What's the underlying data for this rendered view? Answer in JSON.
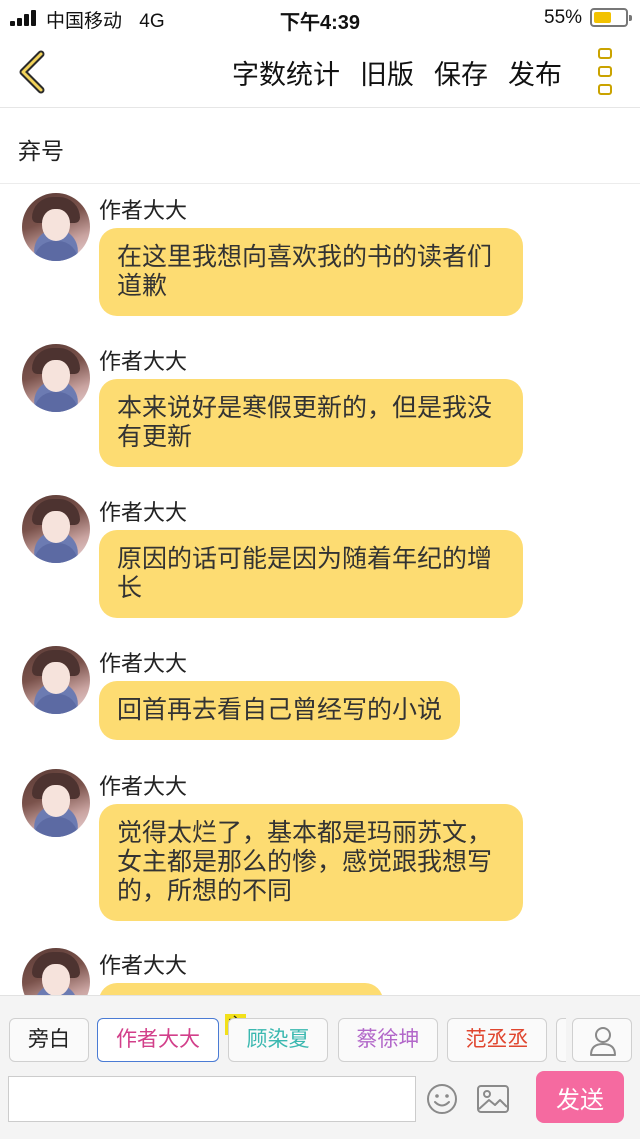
{
  "status_bar": {
    "carrier": "中国移动",
    "network": "4G",
    "time": "下午4:39",
    "battery_percent": "55%",
    "battery_level": 0.55
  },
  "nav": {
    "back_icon": "chevron-left-icon",
    "actions": [
      "字数统计",
      "旧版",
      "保存",
      "发布"
    ],
    "more_icon": "more-vertical-icon",
    "accent_color": "#caa300"
  },
  "chapter": {
    "title": "弃号"
  },
  "messages": [
    {
      "author": "作者大大",
      "text": "在这里我想向喜欢我的书的读者们道歉"
    },
    {
      "author": "作者大大",
      "text": "本来说好是寒假更新的，但是我没有更新"
    },
    {
      "author": "作者大大",
      "text": "原因的话可能是因为随着年纪的增长"
    },
    {
      "author": "作者大大",
      "text": "回首再去看自己曾经写的小说"
    },
    {
      "author": "作者大大",
      "text": "觉得太烂了，基本都是玛丽苏文，女主都是那么的惨，感觉跟我想写的，所想的不同"
    },
    {
      "author": "作者大大",
      "text": ""
    }
  ],
  "bubble_color": "#fddc72",
  "roles": [
    {
      "label": "旁白",
      "color": "#222222"
    },
    {
      "label": "作者大大",
      "color": "#d23f8a"
    },
    {
      "label": "顾染夏",
      "color": "#3bb8b0"
    },
    {
      "label": "蔡徐坤",
      "color": "#b267c9"
    },
    {
      "label": "范丞丞",
      "color": "#e0462f"
    }
  ],
  "owner_badge": "主",
  "input": {
    "placeholder": "",
    "value": ""
  },
  "send": {
    "label": "发送",
    "color": "#f56aa0"
  }
}
